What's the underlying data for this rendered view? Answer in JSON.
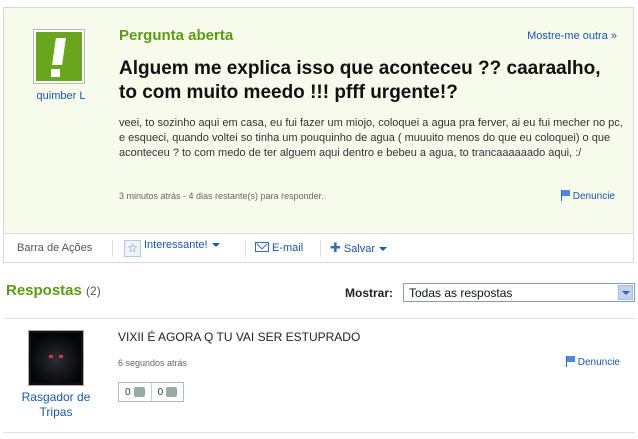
{
  "question": {
    "user_name": "quimber L",
    "status": "Pergunta aberta",
    "another_link": "Mostre-me outra »",
    "title": "Alguem me explica isso que aconteceu ?? caaraalho, to com muito meedo !!! pfff urgente!?",
    "body": "veei, to sozinho aqui em casa, eu fui fazer um miojo, coloquei a agua pra ferver, ai eu fui mecher no pc, e esqueci, quando voltei so tinha um pouquinho de agua ( muuuito menos do que eu coloquei) o que aconteceu ? to com medo de ter alguem aqui dentro e bebeu a agua, to trancaaaaaado aqui, :/",
    "meta": "3 minutos atrás - 4 dias restante(s) para responder.",
    "report": "Denuncie"
  },
  "action_bar": {
    "label": "Barra de Ações",
    "interesting": "Interessante!",
    "email": "E-mail",
    "save": "Salvar"
  },
  "answers": {
    "title": "Respostas",
    "count": "(2)",
    "show_label": "Mostrar:",
    "filter_value": "Todas as respostas",
    "items": [
      {
        "user_name": "Rasgador de Tripas",
        "text": "VIXII É AGORA Q TU VAI SER ESTUPRADO",
        "time": "6 segundos atrás",
        "report": "Denuncie",
        "thumbs_up": "0",
        "thumbs_down": "0"
      }
    ]
  },
  "icons": {
    "logo": "exclamation-icon",
    "report": "flag-icon",
    "interesting": "star-icon",
    "email": "envelope-icon",
    "save": "plus-icon",
    "dropdown": "chevron-down-icon",
    "vote_up": "thumbs-up-icon",
    "vote_down": "thumbs-down-icon"
  },
  "colors": {
    "accent_green": "#5d9b14",
    "link_blue": "#1a57a6",
    "question_bg": "#f6fbec"
  }
}
